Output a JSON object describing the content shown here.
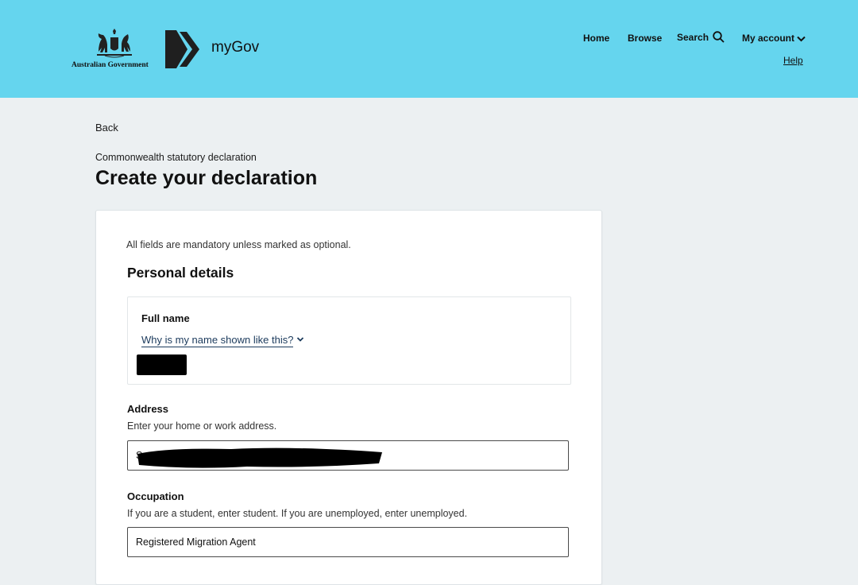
{
  "header": {
    "government_name": "Australian Government",
    "brand": "myGov",
    "nav": {
      "home": "Home",
      "browse": "Browse",
      "search": "Search",
      "my_account": "My account",
      "help": "Help"
    },
    "background_color": "#65d5ee"
  },
  "back_label": "Back",
  "eyebrow": "Commonwealth statutory declaration",
  "page_title": "Create your declaration",
  "form": {
    "mandatory_note": "All fields are mandatory unless marked as optional.",
    "section_title": "Personal details",
    "full_name": {
      "label": "Full name",
      "help_link": "Why is my name shown like this?"
    },
    "address": {
      "label": "Address",
      "hint": "Enter your home or work address.",
      "value": "S"
    },
    "occupation": {
      "label": "Occupation",
      "hint": "If you are a student, enter student. If you are unemployed, enter unemployed.",
      "value": "Registered Migration Agent"
    }
  },
  "icons": {
    "search": "search-icon",
    "account_chevron": "chevron-down-icon",
    "help_chevron": "chevron-down-icon"
  }
}
